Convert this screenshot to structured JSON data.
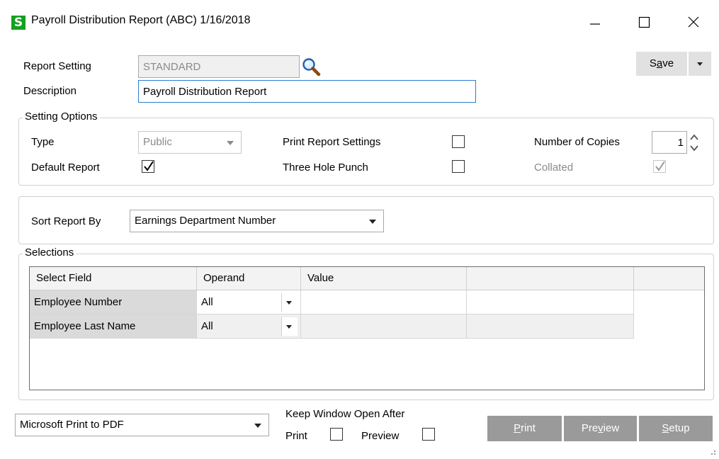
{
  "window": {
    "app_logo": "S",
    "title": "Payroll Distribution Report (ABC) 1/16/2018"
  },
  "report_setting": {
    "label": "Report Setting",
    "value": "STANDARD",
    "lookup_icon": "magnifier-icon"
  },
  "description": {
    "label": "Description",
    "value": "Payroll Distribution Report"
  },
  "save": {
    "label_pre": "S",
    "label_ul": "a",
    "label_post": "ve"
  },
  "setting_options": {
    "title": "Setting Options",
    "type_label": "Type",
    "type_value": "Public",
    "default_report_label": "Default Report",
    "default_report_checked": true,
    "print_report_settings_label": "Print Report Settings",
    "print_report_settings_checked": false,
    "three_hole_punch_label": "Three Hole Punch",
    "three_hole_punch_checked": false,
    "copies_label": "Number of Copies",
    "copies_value": "1",
    "collated_label": "Collated",
    "collated_checked": true
  },
  "sort": {
    "label": "Sort Report By",
    "value": "Earnings Department Number"
  },
  "selections": {
    "title": "Selections",
    "columns": [
      "Select Field",
      "Operand",
      "Value",
      ""
    ],
    "rows": [
      {
        "field": "Employee Number",
        "operand": "All",
        "value": ""
      },
      {
        "field": "Employee Last Name",
        "operand": "All",
        "value": ""
      }
    ]
  },
  "printer": {
    "value": "Microsoft Print to PDF"
  },
  "keep_open": {
    "label": "Keep Window Open After",
    "print_label": "Print",
    "preview_label": "Preview"
  },
  "buttons": {
    "print_ul": "P",
    "print_rest": "rint",
    "preview_pre": "Pre",
    "preview_ul": "v",
    "preview_post": "iew",
    "setup_ul": "S",
    "setup_rest": "etup"
  },
  "colors": {
    "logo_green": "#15a020",
    "focus_blue": "#2b7cd3",
    "button_gray": "#9a9a9a"
  }
}
